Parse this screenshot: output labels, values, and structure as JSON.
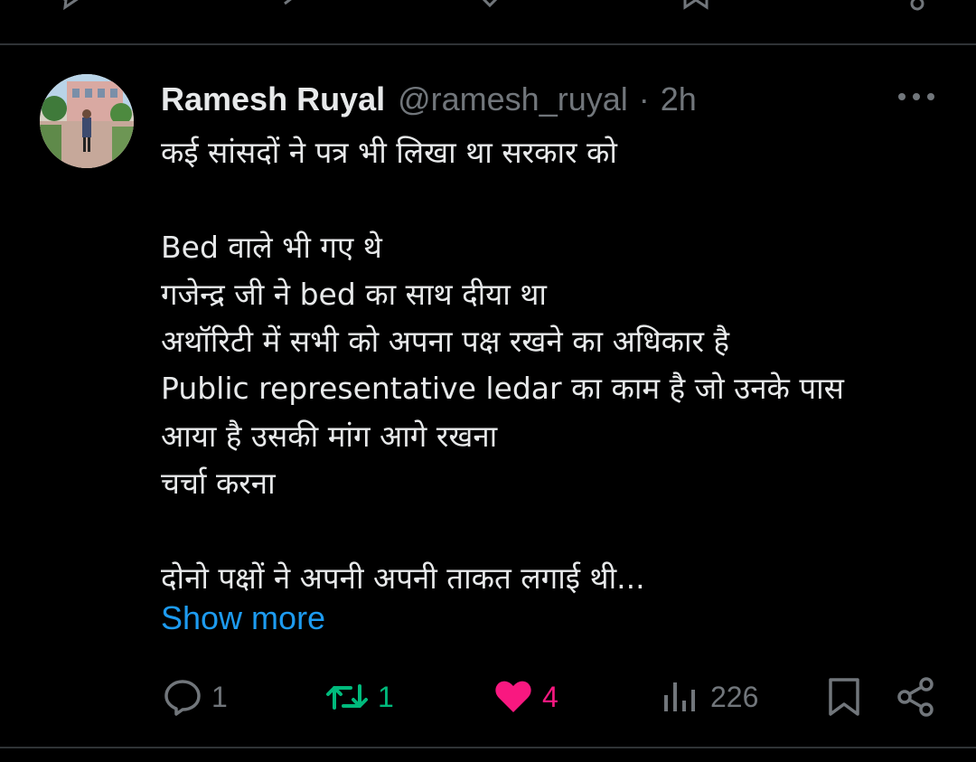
{
  "top_actions": {
    "icons": [
      "reply-icon",
      "retweet-icon",
      "like-icon",
      "bookmark-icon",
      "share-icon"
    ]
  },
  "tweet": {
    "author": {
      "name": "Ramesh Ruyal",
      "handle": "@ramesh_ruyal",
      "separator": "·",
      "time": "2h"
    },
    "text": "कई सांसदों ने पत्र भी लिखा था सरकार को\n\nBed वाले भी गए थे\nगजेन्द्र जी ने bed का साथ दीया था\nअथॉरिटी में सभी को अपना पक्ष रखने का अधिकार है\nPublic representative ledar का काम है जो उनके पास\nआया है उसकी मांग आगे रखना\nचर्चा करना\n\nदोनो पक्षों ने अपनी अपनी ताकत लगाई थी...",
    "show_more_label": "Show more",
    "actions": {
      "reply_count": "1",
      "retweet_count": "1",
      "like_count": "4",
      "views_count": "226"
    }
  },
  "colors": {
    "background": "#000000",
    "text_primary": "#e7e9ea",
    "text_secondary": "#71767b",
    "divider": "#2f3336",
    "link": "#1d9bf0",
    "retweet_active": "#00ba7c",
    "like_active": "#f91880"
  }
}
